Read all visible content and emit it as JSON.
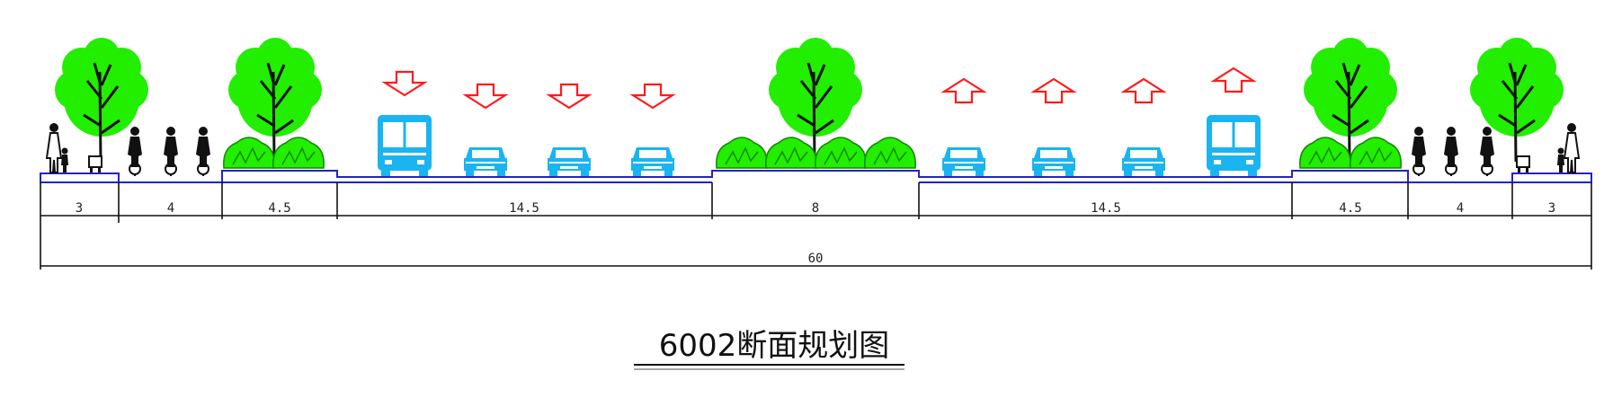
{
  "title": "6002断面规划图",
  "total_width_label": "60",
  "segments": [
    {
      "width": 3,
      "label": "3",
      "type": "sidewalk"
    },
    {
      "width": 4,
      "label": "4",
      "type": "bike-lane"
    },
    {
      "width": 4.5,
      "label": "4.5",
      "type": "green-belt"
    },
    {
      "width": 14.5,
      "label": "14.5",
      "type": "carriageway",
      "direction": "down"
    },
    {
      "width": 8,
      "label": "8",
      "type": "median"
    },
    {
      "width": 14.5,
      "label": "14.5",
      "type": "carriageway",
      "direction": "up"
    },
    {
      "width": 4.5,
      "label": "4.5",
      "type": "green-belt"
    },
    {
      "width": 4,
      "label": "4",
      "type": "bike-lane"
    },
    {
      "width": 3,
      "label": "3",
      "type": "sidewalk"
    }
  ],
  "colors": {
    "tree": "#22ee00",
    "vehicle": "#1ab4f0",
    "arrow": "#ff1a1a",
    "road_line": "#2222cc",
    "dimension": "#111111"
  },
  "icons": [
    "tree-icon",
    "shrub-icon",
    "bus-icon",
    "car-icon",
    "cyclist-icon",
    "pedestrian-icon",
    "bench-icon",
    "direction-arrow-icon"
  ]
}
